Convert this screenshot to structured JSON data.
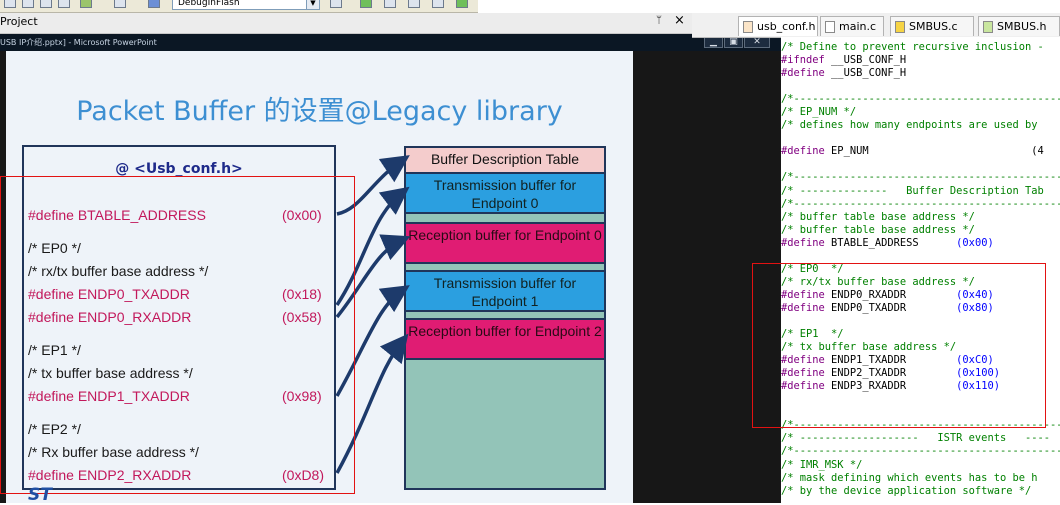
{
  "toolbar": {
    "build_target": "DebugInFlash"
  },
  "project_pane": {
    "title": "Project",
    "pin_glyph": "ᛘ",
    "close_glyph": "×"
  },
  "powerpoint": {
    "window_title": "USB IP介绍.pptx] - Microsoft PowerPoint",
    "min_glyph": "▁",
    "max_glyph": "▣",
    "close_glyph": "✕"
  },
  "slide": {
    "title": "Packet Buffer 的设置@Legacy library",
    "defines_header": "@ <Usb_conf.h>",
    "lines": [
      {
        "text": "#define BTABLE_ADDRESS",
        "value": "(0x00)",
        "style": "pink"
      },
      {
        "text": "/* EP0  */",
        "value": "",
        "style": "dark"
      },
      {
        "text": "/* rx/tx buffer base address */",
        "value": "",
        "style": "dark"
      },
      {
        "text": "#define ENDP0_TXADDR",
        "value": "(0x18)",
        "style": "pink"
      },
      {
        "text": "#define ENDP0_RXADDR",
        "value": "(0x58)",
        "style": "pink"
      },
      {
        "text": "/* EP1  */",
        "value": "",
        "style": "dark"
      },
      {
        "text": "/* tx buffer base address */",
        "value": "",
        "style": "dark"
      },
      {
        "text": "#define ENDP1_TXADDR",
        "value": "(0x98)",
        "style": "pink"
      },
      {
        "text": "/* EP2  */",
        "value": "",
        "style": "dark"
      },
      {
        "text": "/* Rx buffer base address */",
        "value": "",
        "style": "dark"
      },
      {
        "text": "#define ENDP2_RXADDR",
        "value": "(0xD8)",
        "style": "pink"
      }
    ],
    "buffers": [
      {
        "label": "Buffer Description Table",
        "kind": "desc"
      },
      {
        "label": "Transmission buffer for Endpoint 0",
        "kind": "tx"
      },
      {
        "label": "",
        "kind": "empty"
      },
      {
        "label": "Reception buffer for Endpoint 0",
        "kind": "rx"
      },
      {
        "label": "",
        "kind": "empty"
      },
      {
        "label": "Transmission buffer for Endpoint 1",
        "kind": "tx"
      },
      {
        "label": "",
        "kind": "empty"
      },
      {
        "label": "Reception buffer for Endpoint 2",
        "kind": "rx"
      }
    ],
    "logo_text": "ST"
  },
  "editor": {
    "tabs": [
      {
        "label": "usb_conf.h",
        "active": true,
        "color": "orange"
      },
      {
        "label": "main.c",
        "active": false,
        "color": "white"
      },
      {
        "label": "SMBUS.c",
        "active": false,
        "color": "yellow"
      },
      {
        "label": "SMBUS.h",
        "active": false,
        "color": "green"
      }
    ],
    "code_lines": [
      [
        {
          "t": "/* Define to prevent recursive inclusion -",
          "k": "c"
        }
      ],
      [
        {
          "t": "#ifndef",
          "k": "p"
        },
        {
          "t": " __USB_CONF_H",
          "k": "t"
        }
      ],
      [
        {
          "t": "#define",
          "k": "p"
        },
        {
          "t": " __USB_CONF_H",
          "k": "t"
        }
      ],
      [
        {
          "t": "",
          "k": "t"
        }
      ],
      [
        {
          "t": "/*--------------------------------------------",
          "k": "c"
        }
      ],
      [
        {
          "t": "/* EP_NUM */",
          "k": "c"
        }
      ],
      [
        {
          "t": "/* defines how many endpoints are used by",
          "k": "c"
        }
      ],
      [
        {
          "t": "",
          "k": "t"
        }
      ],
      [
        {
          "t": "#define",
          "k": "p"
        },
        {
          "t": " EP_NUM                          (4",
          "k": "t"
        }
      ],
      [
        {
          "t": "",
          "k": "t"
        }
      ],
      [
        {
          "t": "/*--------------------------------------------",
          "k": "c"
        }
      ],
      [
        {
          "t": "/* --------------   Buffer Description Tab",
          "k": "c"
        }
      ],
      [
        {
          "t": "/*--------------------------------------------",
          "k": "c"
        }
      ],
      [
        {
          "t": "/* buffer table base address */",
          "k": "c"
        }
      ],
      [
        {
          "t": "/* buffer table base address */",
          "k": "c"
        }
      ],
      [
        {
          "t": "#define",
          "k": "p"
        },
        {
          "t": " BTABLE_ADDRESS      ",
          "k": "t"
        },
        {
          "t": "(0x00)",
          "k": "n"
        }
      ],
      [
        {
          "t": "",
          "k": "t"
        }
      ],
      [
        {
          "t": "/* EP0  */",
          "k": "c"
        }
      ],
      [
        {
          "t": "/* rx/tx buffer base address */",
          "k": "c"
        }
      ],
      [
        {
          "t": "#define",
          "k": "p"
        },
        {
          "t": " ENDP0_RXADDR        ",
          "k": "t"
        },
        {
          "t": "(0x40)",
          "k": "n"
        }
      ],
      [
        {
          "t": "#define",
          "k": "p"
        },
        {
          "t": " ENDP0_TXADDR        ",
          "k": "t"
        },
        {
          "t": "(0x80)",
          "k": "n"
        }
      ],
      [
        {
          "t": "",
          "k": "t"
        }
      ],
      [
        {
          "t": "/* EP1  */",
          "k": "c"
        }
      ],
      [
        {
          "t": "/* tx buffer base address */",
          "k": "c"
        }
      ],
      [
        {
          "t": "#define",
          "k": "p"
        },
        {
          "t": " ENDP1_TXADDR        ",
          "k": "t"
        },
        {
          "t": "(0xC0)",
          "k": "n"
        }
      ],
      [
        {
          "t": "#define",
          "k": "p"
        },
        {
          "t": " ENDP2_TXADDR        ",
          "k": "t"
        },
        {
          "t": "(0x100)",
          "k": "n"
        }
      ],
      [
        {
          "t": "#define",
          "k": "p"
        },
        {
          "t": " ENDP3_RXADDR        ",
          "k": "t"
        },
        {
          "t": "(0x110)",
          "k": "n"
        }
      ],
      [
        {
          "t": "",
          "k": "t"
        }
      ],
      [
        {
          "t": "",
          "k": "t"
        }
      ],
      [
        {
          "t": "/*--------------------------------------------",
          "k": "c"
        }
      ],
      [
        {
          "t": "/* -------------------   ISTR events   ----",
          "k": "c"
        }
      ],
      [
        {
          "t": "/*--------------------------------------------",
          "k": "c"
        }
      ],
      [
        {
          "t": "/* IMR_MSK */",
          "k": "c"
        }
      ],
      [
        {
          "t": "/* mask defining which events has to be h",
          "k": "c"
        }
      ],
      [
        {
          "t": "/* by the device application software */",
          "k": "c"
        }
      ]
    ]
  },
  "colors": {
    "slide_title": "#3d8fd2",
    "define_pink": "#c2185b",
    "tx_buffer": "#2b9fe0",
    "rx_buffer": "#e01c73",
    "desc_buffer": "#f4cccc",
    "empty_buffer": "#93c4b8",
    "highlight_red": "#e21212",
    "arrow_navy": "#1d3a6b"
  }
}
